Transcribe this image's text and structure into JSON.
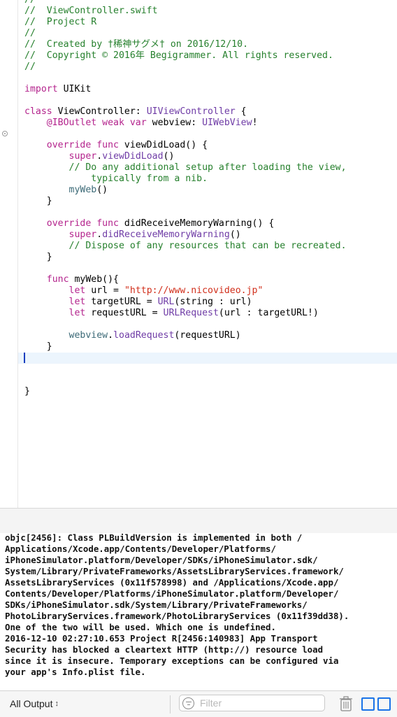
{
  "editor": {
    "lines": [
      [
        {
          "c": "cm",
          "t": "//"
        }
      ],
      [
        {
          "c": "cm",
          "t": "//  ViewController.swift"
        }
      ],
      [
        {
          "c": "cm",
          "t": "//  Project R"
        }
      ],
      [
        {
          "c": "cm",
          "t": "//"
        }
      ],
      [
        {
          "c": "cm",
          "t": "//  Created by †稀神サグメ† on 2016/12/10."
        }
      ],
      [
        {
          "c": "cm",
          "t": "//  Copyright © 2016年 Begigrammer. All rights reserved."
        }
      ],
      [
        {
          "c": "cm",
          "t": "//"
        }
      ],
      [],
      [
        {
          "c": "kw",
          "t": "import"
        },
        {
          "c": "tx",
          "t": " UIKit"
        }
      ],
      [],
      [
        {
          "c": "kw",
          "t": "class"
        },
        {
          "c": "tx",
          "t": " ViewController: "
        },
        {
          "c": "ty",
          "t": "UIViewController"
        },
        {
          "c": "tx",
          "t": " {"
        }
      ],
      [
        {
          "c": "tx",
          "t": "    "
        },
        {
          "c": "kw",
          "t": "@IBOutlet weak var"
        },
        {
          "c": "tx",
          "t": " webview: "
        },
        {
          "c": "ty",
          "t": "UIWebView"
        },
        {
          "c": "tx",
          "t": "!"
        }
      ],
      [],
      [
        {
          "c": "tx",
          "t": "    "
        },
        {
          "c": "kw",
          "t": "override func"
        },
        {
          "c": "tx",
          "t": " viewDidLoad() {"
        }
      ],
      [
        {
          "c": "tx",
          "t": "        "
        },
        {
          "c": "kw",
          "t": "super"
        },
        {
          "c": "tx",
          "t": "."
        },
        {
          "c": "ob",
          "t": "viewDidLoad"
        },
        {
          "c": "tx",
          "t": "()"
        }
      ],
      [
        {
          "c": "tx",
          "t": "        "
        },
        {
          "c": "cm",
          "t": "// Do any additional setup after loading the view,"
        }
      ],
      [
        {
          "c": "cm",
          "t": "            typically from a nib."
        }
      ],
      [
        {
          "c": "tx",
          "t": "        "
        },
        {
          "c": "fn",
          "t": "myWeb"
        },
        {
          "c": "tx",
          "t": "()"
        }
      ],
      [
        {
          "c": "tx",
          "t": "    }"
        }
      ],
      [],
      [
        {
          "c": "tx",
          "t": "    "
        },
        {
          "c": "kw",
          "t": "override func"
        },
        {
          "c": "tx",
          "t": " didReceiveMemoryWarning() {"
        }
      ],
      [
        {
          "c": "tx",
          "t": "        "
        },
        {
          "c": "kw",
          "t": "super"
        },
        {
          "c": "tx",
          "t": "."
        },
        {
          "c": "ob",
          "t": "didReceiveMemoryWarning"
        },
        {
          "c": "tx",
          "t": "()"
        }
      ],
      [
        {
          "c": "tx",
          "t": "        "
        },
        {
          "c": "cm",
          "t": "// Dispose of any resources that can be recreated."
        }
      ],
      [
        {
          "c": "tx",
          "t": "    }"
        }
      ],
      [],
      [
        {
          "c": "tx",
          "t": "    "
        },
        {
          "c": "kw",
          "t": "func"
        },
        {
          "c": "tx",
          "t": " myWeb(){"
        }
      ],
      [
        {
          "c": "tx",
          "t": "        "
        },
        {
          "c": "kw",
          "t": "let"
        },
        {
          "c": "tx",
          "t": " url = "
        },
        {
          "c": "st",
          "t": "\"http://www.nicovideo.jp\""
        }
      ],
      [
        {
          "c": "tx",
          "t": "        "
        },
        {
          "c": "kw",
          "t": "let"
        },
        {
          "c": "tx",
          "t": " targetURL = "
        },
        {
          "c": "ty",
          "t": "URL"
        },
        {
          "c": "tx",
          "t": "(string : url)"
        }
      ],
      [
        {
          "c": "tx",
          "t": "        "
        },
        {
          "c": "kw",
          "t": "let"
        },
        {
          "c": "tx",
          "t": " requestURL = "
        },
        {
          "c": "ty",
          "t": "URLRequest"
        },
        {
          "c": "tx",
          "t": "(url : targetURL!)"
        }
      ],
      [],
      [
        {
          "c": "tx",
          "t": "        "
        },
        {
          "c": "fn",
          "t": "webview"
        },
        {
          "c": "tx",
          "t": "."
        },
        {
          "c": "ob",
          "t": "loadRequest"
        },
        {
          "c": "tx",
          "t": "(requestURL)"
        }
      ],
      [
        {
          "c": "tx",
          "t": "    }"
        }
      ],
      [],
      [],
      [],
      [
        {
          "c": "tx",
          "t": "}"
        }
      ]
    ],
    "current_line_index": 32
  },
  "console": {
    "text": "objc[2456]: Class PLBuildVersion is implemented in both /\nApplications/Xcode.app/Contents/Developer/Platforms/\niPhoneSimulator.platform/Developer/SDKs/iPhoneSimulator.sdk/\nSystem/Library/PrivateFrameworks/AssetsLibraryServices.framework/\nAssetsLibraryServices (0x11f578998) and /Applications/Xcode.app/\nContents/Developer/Platforms/iPhoneSimulator.platform/Developer/\nSDKs/iPhoneSimulator.sdk/System/Library/PrivateFrameworks/\nPhotoLibraryServices.framework/PhotoLibraryServices (0x11f39dd38).\nOne of the two will be used. Which one is undefined.\n2016-12-10 02:27:10.653 Project R[2456:140983] App Transport\nSecurity has blocked a cleartext HTTP (http://) resource load\nsince it is insecure. Temporary exceptions can be configured via\nyour app's Info.plist file."
  },
  "bottom_bar": {
    "output_label": "All Output",
    "output_chevron": "⌃⌄",
    "filter_placeholder": "Filter"
  },
  "colors": {
    "comment": "#26802d",
    "keyword": "#b4248d",
    "type": "#6f3ca6",
    "project_symbol": "#3c6a77",
    "string": "#d12f1b",
    "accent": "#1a73e8"
  },
  "icons": {
    "breakpoint": "breakpoint-marker-icon",
    "filter": "filter-icon",
    "trash": "trash-icon",
    "split_left": "split-left-icon",
    "split_right": "split-right-icon"
  }
}
